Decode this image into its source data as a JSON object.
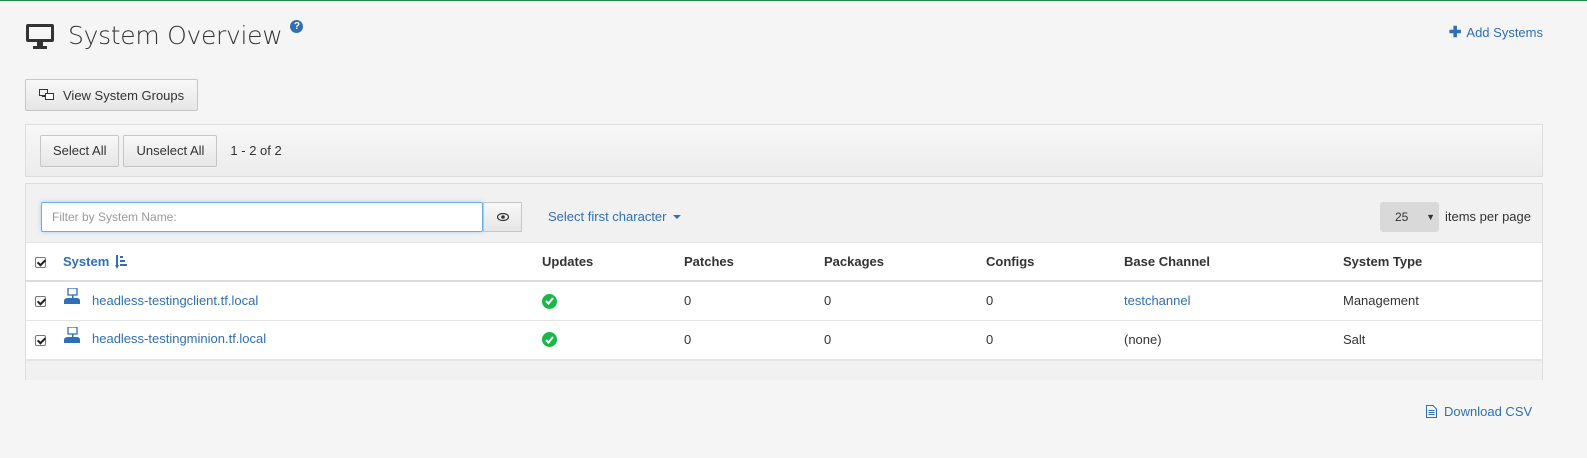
{
  "header": {
    "title": "System Overview",
    "help_glyph": "?",
    "add_systems_label": "Add Systems",
    "icon": "monitor-icon"
  },
  "view_groups_label": "View System Groups",
  "selection": {
    "select_all_label": "Select All",
    "unselect_all_label": "Unselect All",
    "range_text": "1 - 2 of 2"
  },
  "toolbar": {
    "filter_placeholder": "Filter by System Name:",
    "filter_value": "",
    "first_char_label": "Select first character",
    "per_page_value": "25",
    "per_page_label": "items per page"
  },
  "table": {
    "columns": [
      "System",
      "Updates",
      "Patches",
      "Packages",
      "Configs",
      "Base Channel",
      "System Type"
    ],
    "rows": [
      {
        "checked": true,
        "system": "headless-testingclient.tf.local",
        "updates": "ok",
        "patches": "0",
        "packages": "0",
        "configs": "0",
        "base_channel": "testchannel",
        "base_channel_is_link": true,
        "system_type": "Management"
      },
      {
        "checked": true,
        "system": "headless-testingminion.tf.local",
        "updates": "ok",
        "patches": "0",
        "packages": "0",
        "configs": "0",
        "base_channel": "(none)",
        "base_channel_is_link": false,
        "system_type": "Salt"
      }
    ]
  },
  "download_csv_label": "Download CSV",
  "colors": {
    "link": "#2f6fb5",
    "success": "#1cb54b",
    "top_border": "#1f8a4c"
  }
}
